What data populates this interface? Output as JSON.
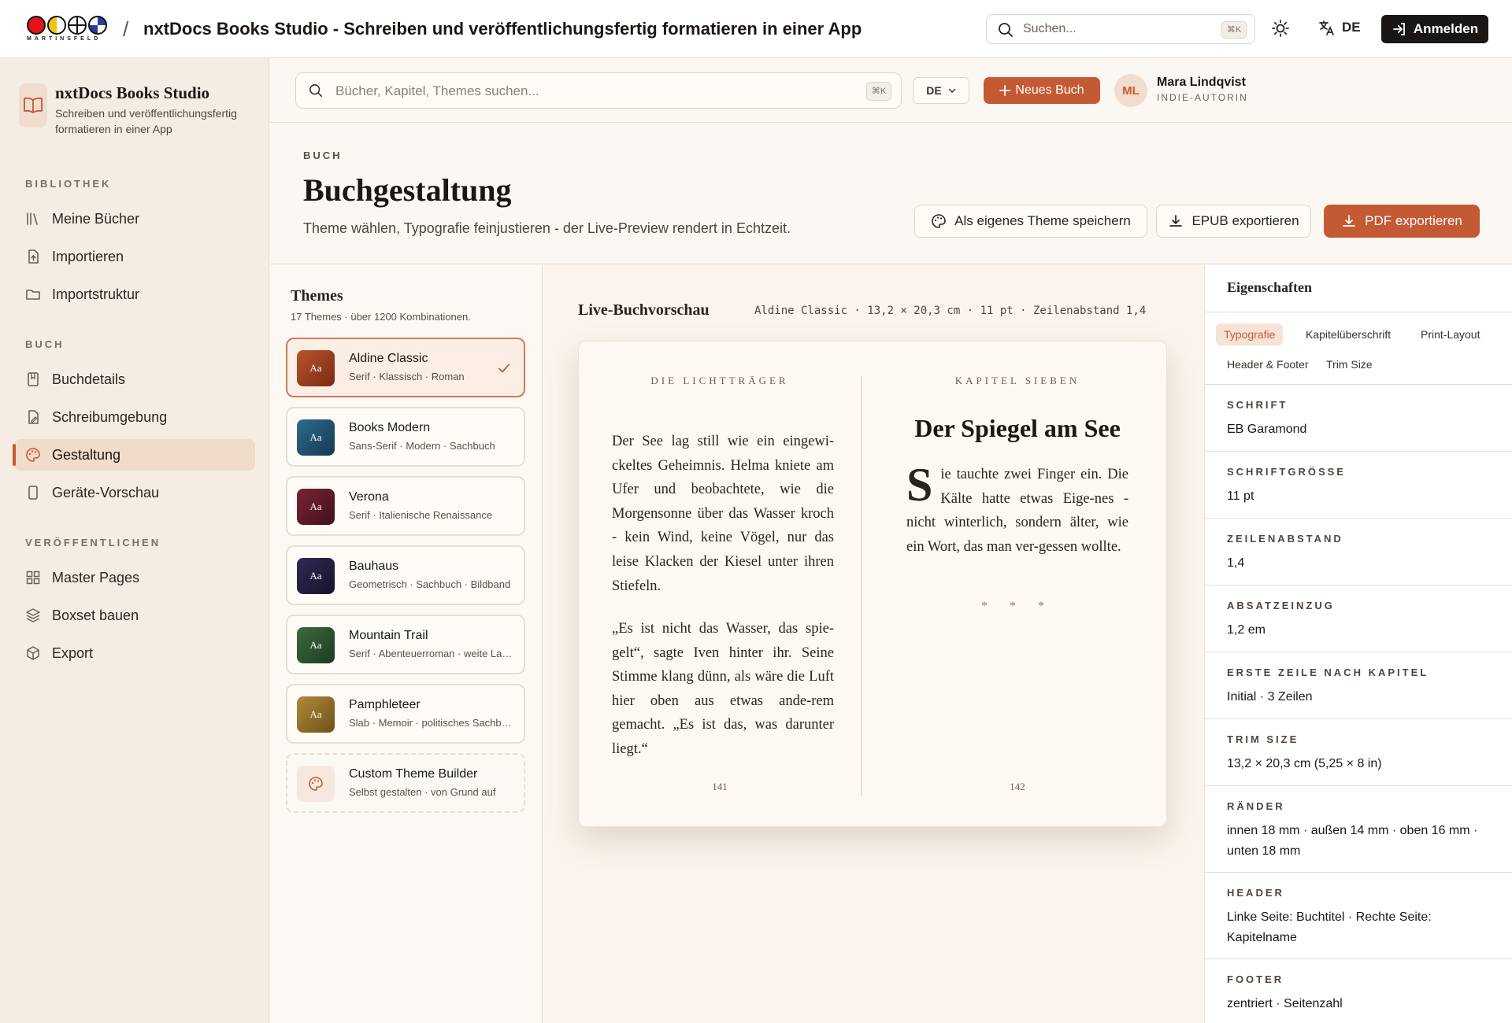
{
  "topbar": {
    "logo_text": "MARTINSFELD",
    "separator": "/",
    "app_title": "nxtDocs Books Studio - Schreiben und veröffentlichungsfertig formatieren in einer App",
    "search_placeholder": "Suchen...",
    "search_shortcut": "⌘K",
    "language": "DE",
    "login_label": "Anmelden",
    "logo_colors": [
      "#e3131a",
      "#f3c316",
      "#ffffff",
      "#2b3e9e"
    ]
  },
  "sidebar": {
    "brand_name": "nxtDocs Books Studio",
    "brand_sub": "Schreiben und veröffentlichungsfertig formatieren in einer App",
    "sections": [
      {
        "label": "BIBLIOTHEK",
        "items": [
          {
            "label": "Meine Bücher",
            "icon": "library-icon"
          },
          {
            "label": "Importieren",
            "icon": "import-icon"
          },
          {
            "label": "Importstruktur",
            "icon": "folder-icon"
          }
        ]
      },
      {
        "label": "BUCH",
        "items": [
          {
            "label": "Buchdetails",
            "icon": "book-icon"
          },
          {
            "label": "Schreibumgebung",
            "icon": "edit-doc-icon"
          },
          {
            "label": "Gestaltung",
            "icon": "palette-icon",
            "active": true
          },
          {
            "label": "Geräte-Vorschau",
            "icon": "device-icon"
          }
        ]
      },
      {
        "label": "VERÖFFENTLICHEN",
        "items": [
          {
            "label": "Master Pages",
            "icon": "grid-icon"
          },
          {
            "label": "Boxset bauen",
            "icon": "layers-icon"
          },
          {
            "label": "Export",
            "icon": "package-icon"
          }
        ]
      }
    ]
  },
  "subbar": {
    "search_placeholder": "Bücher, Kapitel, Themes suchen...",
    "search_shortcut": "⌘K",
    "language": "DE",
    "new_book_label": "Neues Buch",
    "user_initials": "ML",
    "user_name": "Mara Lindqvist",
    "user_role": "INDIE-AUTORIN"
  },
  "page": {
    "eyebrow": "BUCH",
    "title": "Buchgestaltung",
    "subtitle": "Theme wählen, Typografie feinjustieren - der Live-Preview rendert in Echtzeit.",
    "save_theme_label": "Als eigenes Theme speichern",
    "epub_label": "EPUB exportieren",
    "pdf_label": "PDF exportieren"
  },
  "themes": {
    "title": "Themes",
    "subtitle": "17 Themes · über 1200 Kombinationen.",
    "items": [
      {
        "name": "Aldine Classic",
        "meta": "Serif · Klassisch · Roman",
        "swatch": "Aa",
        "color_a": "#b9542e",
        "color_b": "#7a2a14",
        "selected": true
      },
      {
        "name": "Books Modern",
        "meta": "Sans-Serif · Modern · Sachbuch",
        "swatch": "Aa",
        "color_a": "#2d6c8e",
        "color_b": "#17384f"
      },
      {
        "name": "Verona",
        "meta": "Serif · Italienische Renaissance",
        "swatch": "Aa",
        "color_a": "#7a2335",
        "color_b": "#43101c"
      },
      {
        "name": "Bauhaus",
        "meta": "Geometrisch · Sachbuch · Bildband",
        "swatch": "Aa",
        "color_a": "#2f2a52",
        "color_b": "#16132e"
      },
      {
        "name": "Mountain Trail",
        "meta": "Serif · Abenteuerroman · weite Landschaft",
        "swatch": "Aa",
        "color_a": "#3c6b3f",
        "color_b": "#1d3b22"
      },
      {
        "name": "Pamphleteer",
        "meta": "Slab · Memoir · politisches Sachbuch",
        "swatch": "Aa",
        "color_a": "#b08a3a",
        "color_b": "#6e5118"
      }
    ],
    "custom": {
      "name": "Custom Theme Builder",
      "meta": "Selbst gestalten · von Grund auf"
    }
  },
  "preview": {
    "title": "Live-Buchvorschau",
    "meta": "Aldine Classic · 13,2 × 20,3 cm · 11 pt · Zeilenabstand 1,4",
    "left_runhead": "DIE LICHTTRÄGER",
    "right_runhead": "KAPITEL SIEBEN",
    "left_p1": "Der See lag still wie ein eingewi-ckeltes Geheimnis. Helma kniete am Ufer und beobachtete, wie die Morgensonne über das Wasser kroch - kein Wind, keine Vögel, nur das leise Klacken der Kiesel unter ihren Stiefeln.",
    "left_p2": "„Es ist nicht das Wasser, das spie-gelt“, sagte Iven hinter ihr. Seine Stimme klang dünn, als wäre die Luft hier oben aus etwas ande-rem gemacht. „Es ist das, was darunter liegt.“",
    "chapter_title": "Der Spiegel am See",
    "dropcap": "S",
    "right_p1": "ie tauchte zwei Finger ein. Die Kälte hatte etwas Eige-nes - nicht winterlich, sondern älter, wie ein Wort, das man ver-gessen wollte.",
    "ornament": "* * *",
    "left_folio": "141",
    "right_folio": "142"
  },
  "properties": {
    "title": "Eigenschaften",
    "tabs": [
      "Typografie",
      "Kapitelüberschrift",
      "Print-Layout",
      "Header & Footer",
      "Trim Size"
    ],
    "rows": [
      {
        "label": "SCHRIFT",
        "value": "EB Garamond"
      },
      {
        "label": "SCHRIFTGRÖSSE",
        "value": "11 pt"
      },
      {
        "label": "ZEILENABSTAND",
        "value": "1,4"
      },
      {
        "label": "ABSATZEINZUG",
        "value": "1,2 em"
      },
      {
        "label": "ERSTE ZEILE NACH KAPITEL",
        "value": "Initial · 3 Zeilen"
      },
      {
        "label": "TRIM SIZE",
        "value": "13,2 × 20,3 cm (5,25 × 8 in)"
      },
      {
        "label": "RÄNDER",
        "value": "innen 18 mm · außen 14 mm · oben 16 mm · unten 18 mm"
      },
      {
        "label": "HEADER",
        "value": "Linke Seite: Buchtitel · Rechte Seite: Kapitelname"
      },
      {
        "label": "FOOTER",
        "value": "zentriert · Seitenzahl"
      }
    ]
  },
  "colors": {
    "accent": "#c45a33",
    "sidebar_bg": "#f5ede4",
    "dark": "#1a1614"
  }
}
